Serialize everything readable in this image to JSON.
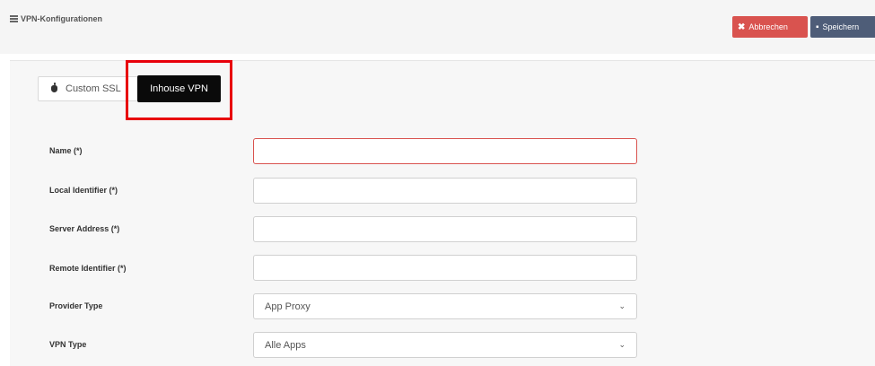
{
  "header": {
    "title": "VPN-Konfigurationen",
    "cancel_label": "Abbrechen",
    "save_label": "Speichern"
  },
  "tabs": [
    {
      "label": "Custom SSL"
    },
    {
      "label": "Inhouse VPN"
    }
  ],
  "form": {
    "name_label": "Name (*)",
    "name_value": "",
    "local_identifier_label": "Local Identifier (*)",
    "local_identifier_value": "",
    "server_address_label": "Server Address (*)",
    "server_address_value": "",
    "remote_identifier_label": "Remote Identifier (*)",
    "remote_identifier_value": "",
    "provider_type_label": "Provider Type",
    "provider_type_value": "App Proxy",
    "vpn_type_label": "VPN Type",
    "vpn_type_value": "Alle Apps"
  },
  "colors": {
    "cancel": "#d9534f",
    "save": "#4e5d78",
    "active_tab": "#0a0a0a",
    "highlight": "#e8000b"
  }
}
